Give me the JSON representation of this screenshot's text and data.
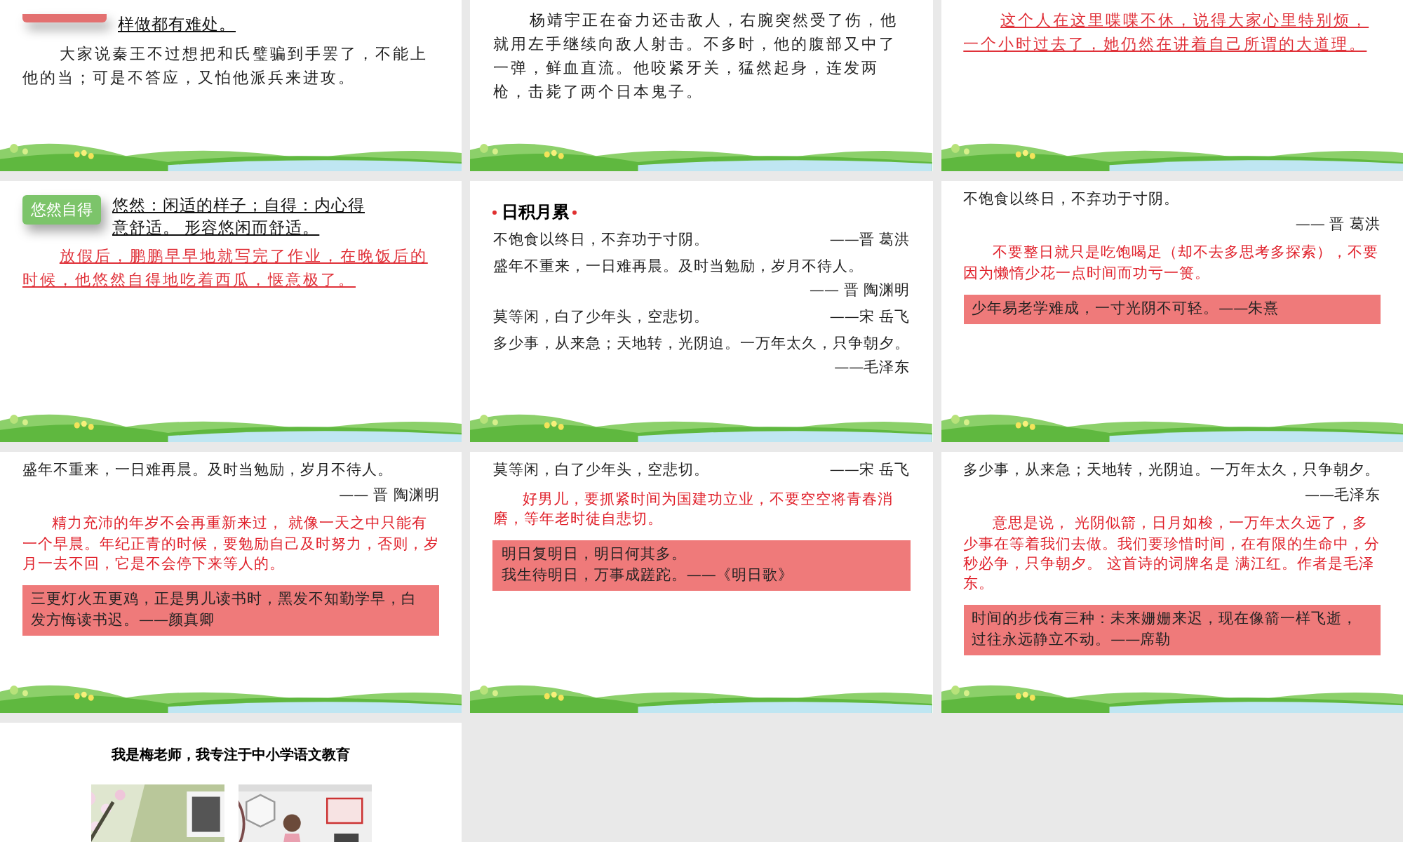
{
  "slides": [
    {
      "blocks": [
        {
          "kind": "term",
          "color": "#e37070",
          "definition": "样做都有难处。"
        },
        {
          "kind": "paragraph",
          "text": "大家说秦王不过想把和氏璧骗到手罢了，不能上他的当；可是不答应，又怕他派兵来进攻。"
        }
      ]
    },
    {
      "blocks": [
        {
          "kind": "paragraph",
          "text": "杨靖宇正在奋力还击敌人，右腕突然受了伤，他就用左手继续向敌人射击。不多时，他的腹部又中了一弹，鲜血直流。他咬紧牙关，猛然起身，连发两枪，击毙了两个日本鬼子。"
        }
      ]
    },
    {
      "blocks": [
        {
          "kind": "red_paragraph",
          "text": "这个人在这里喋喋不休，说得大家心里特别烦，一个小时过去了，她仍然在讲着自己所谓的大道理。"
        }
      ]
    },
    {
      "blocks": [
        {
          "kind": "term",
          "color": "#7cc46a",
          "tag": "悠然自得",
          "definition": "悠然：闲适的样子；自得：内心得意舒适。 形容悠闲而舒适。"
        },
        {
          "kind": "red_paragraph",
          "text": "放假后，鹏鹏早早地就写完了作业，在晚饭后的时候，他悠然自得地吃着西瓜，惬意极了。"
        }
      ]
    },
    {
      "blocks": [
        {
          "kind": "heading",
          "text": "日积月累"
        },
        {
          "kind": "line",
          "text": "不饱食以终日，不弃功于寸阴。",
          "author": "——晋 葛洪"
        },
        {
          "kind": "line",
          "text": "盛年不重来，一日难再晨。及时当勉励，岁月不待人。"
        },
        {
          "kind": "attribution",
          "text": "—— 晋 陶渊明"
        },
        {
          "kind": "line",
          "text": "莫等闲，白了少年头，空悲切。",
          "author": "——宋 岳飞"
        },
        {
          "kind": "line",
          "text": "多少事，从来急；天地转，光阴迫。一万年太久，只争朝夕。"
        },
        {
          "kind": "attribution",
          "text": "——毛泽东"
        }
      ]
    },
    {
      "blocks": [
        {
          "kind": "line",
          "text": "不饱食以终日，不弃功于寸阴。"
        },
        {
          "kind": "attribution",
          "text": "—— 晋 葛洪"
        },
        {
          "kind": "red_note",
          "text": "不要整日就只是吃饱喝足（却不去多思考多探索），不要因为懒惰少花一点时间而功亏一篑。"
        },
        {
          "kind": "banner",
          "lines": [
            "少年易老学难成，一寸光阴不可轻。——朱熹"
          ]
        }
      ]
    },
    {
      "blocks": [
        {
          "kind": "line",
          "text": "盛年不重来，一日难再晨。及时当勉励，岁月不待人。"
        },
        {
          "kind": "attribution",
          "text": "—— 晋 陶渊明"
        },
        {
          "kind": "red_note",
          "text": "精力充沛的年岁不会再重新来过， 就像一天之中只能有一个早晨。年纪正青的时候，要勉励自己及时努力，否则，岁月一去不回，它是不会停下来等人的。"
        },
        {
          "kind": "banner",
          "lines": [
            "三更灯火五更鸡，正是男儿读书时，黑发不知勤学早，白发方悔读书迟。——颜真卿"
          ]
        }
      ]
    },
    {
      "blocks": [
        {
          "kind": "line",
          "text": "莫等闲，白了少年头，空悲切。",
          "author": "——宋 岳飞"
        },
        {
          "kind": "red_note",
          "text": "好男儿，要抓紧时间为国建功立业，不要空空将青春消磨，等年老时徒自悲切。"
        },
        {
          "kind": "banner",
          "lines": [
            "明日复明日，明日何其多。",
            "我生待明日，万事成蹉跎。——《明日歌》"
          ]
        }
      ]
    },
    {
      "blocks": [
        {
          "kind": "line",
          "text": "多少事，从来急；天地转，光阴迫。一万年太久，只争朝夕。"
        },
        {
          "kind": "attribution",
          "text": "——毛泽东"
        },
        {
          "kind": "red_note",
          "text": "意思是说， 光阴似箭，日月如梭，一万年太久远了，多少事在等着我们去做。我们要珍惜时间，在有限的生命中，分秒必争，只争朝夕。 这首诗的词牌名是 满江红。作者是毛泽东。"
        },
        {
          "kind": "banner",
          "lines": [
            "时间的步伐有三种：未来姗姗来迟，现在像箭一样飞逝，过往永远静立不动。——席勒"
          ]
        }
      ]
    },
    {
      "blocks": [
        {
          "kind": "caption",
          "text": "我是梅老师，我专注于中小学语文教育"
        },
        {
          "kind": "pictures"
        }
      ]
    }
  ]
}
